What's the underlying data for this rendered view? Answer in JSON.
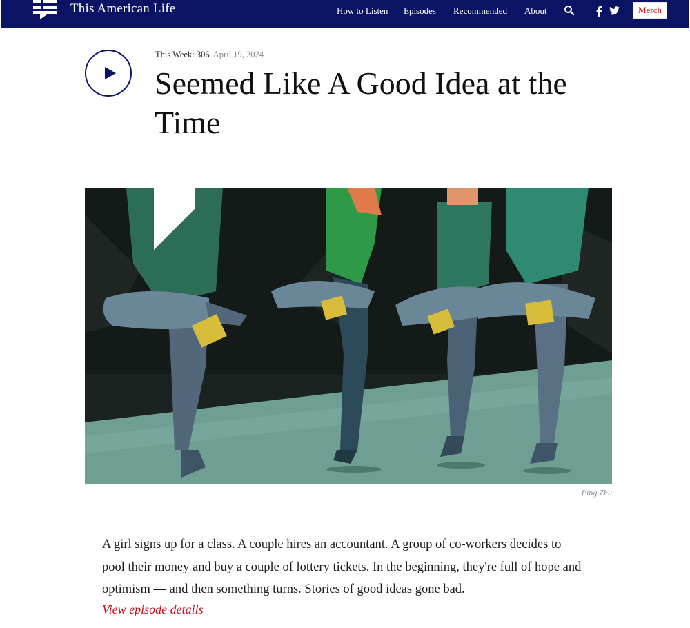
{
  "header": {
    "site_title": "This American Life",
    "nav": [
      "How to Listen",
      "Episodes",
      "Recommended",
      "About"
    ],
    "merch_label": "Merch",
    "icons": [
      "logo-icon",
      "search-icon",
      "facebook-icon",
      "twitter-icon"
    ]
  },
  "episode": {
    "week_label": "This Week: 306",
    "date": "April 19, 2024",
    "title": "Seemed Like A Good Idea at the Time",
    "image_credit": "Ping Zhu",
    "description": "A girl signs up for a class. A couple hires an accountant. A group of co-workers decides to pool their money and buy a couple of lottery tickets. In the beginning, they're full of hope and optimism — and then something turns. Stories of good ideas gone bad.",
    "details_link": "View episode details"
  },
  "colors": {
    "navy": "#0b1464",
    "red": "#c1121f"
  }
}
